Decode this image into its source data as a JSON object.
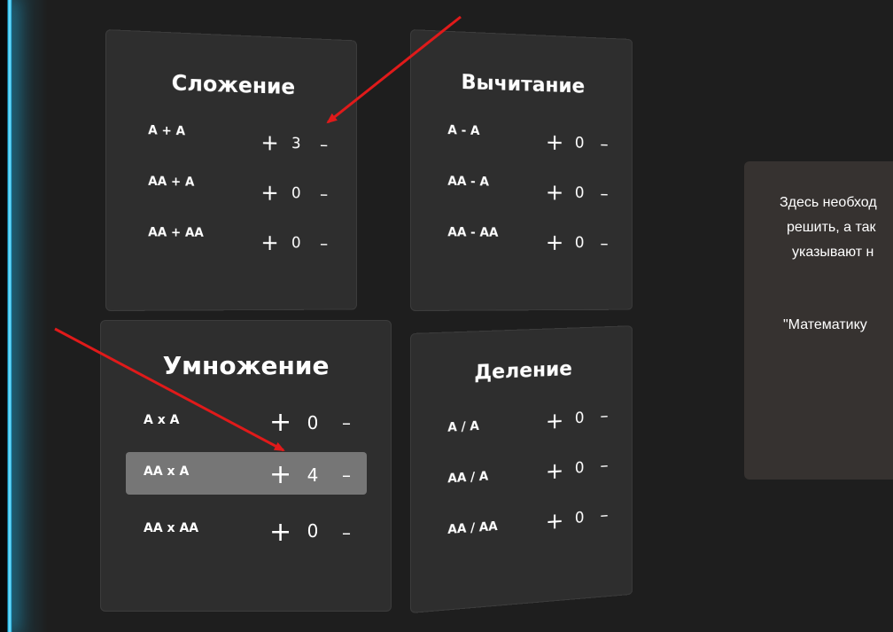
{
  "panels": {
    "addition": {
      "title": "Сложение",
      "rows": [
        {
          "label": "A + A",
          "plus": "+",
          "count": "3",
          "minus": "–"
        },
        {
          "label": "AA + A",
          "plus": "+",
          "count": "0",
          "minus": "–"
        },
        {
          "label": "AA + AA",
          "plus": "+",
          "count": "0",
          "minus": "–"
        }
      ]
    },
    "subtraction": {
      "title": "Вычитание",
      "rows": [
        {
          "label": "A - A",
          "plus": "+",
          "count": "0",
          "minus": "–"
        },
        {
          "label": "AA - A",
          "plus": "+",
          "count": "0",
          "minus": "–"
        },
        {
          "label": "AA - AA",
          "plus": "+",
          "count": "0",
          "minus": "–"
        }
      ]
    },
    "multiplication": {
      "title": "Умножение",
      "rows": [
        {
          "label": "A x A",
          "plus": "+",
          "count": "0",
          "minus": "–"
        },
        {
          "label": "AA x A",
          "plus": "+",
          "count": "4",
          "minus": "–",
          "selected": true
        },
        {
          "label": "AA x AA",
          "plus": "+",
          "count": "0",
          "minus": "–"
        }
      ]
    },
    "division": {
      "title": "Деление",
      "rows": [
        {
          "label": "A / A",
          "plus": "+",
          "count": "0",
          "minus": "–"
        },
        {
          "label": "AA / A",
          "plus": "+",
          "count": "0",
          "minus": "–"
        },
        {
          "label": "AA / AA",
          "plus": "+",
          "count": "0",
          "minus": "–"
        }
      ]
    }
  },
  "info": {
    "line1": "Здесь необход",
    "line2": "решить, а так",
    "line3": "указывают н",
    "line4": "\"Математику"
  },
  "colors": {
    "background": "#1e1e1e",
    "panel": "#2e2e2e",
    "highlight": "#767676",
    "info_card": "#363230",
    "edge_glow": "#1fb6e8",
    "arrow": "#e01a1a"
  }
}
